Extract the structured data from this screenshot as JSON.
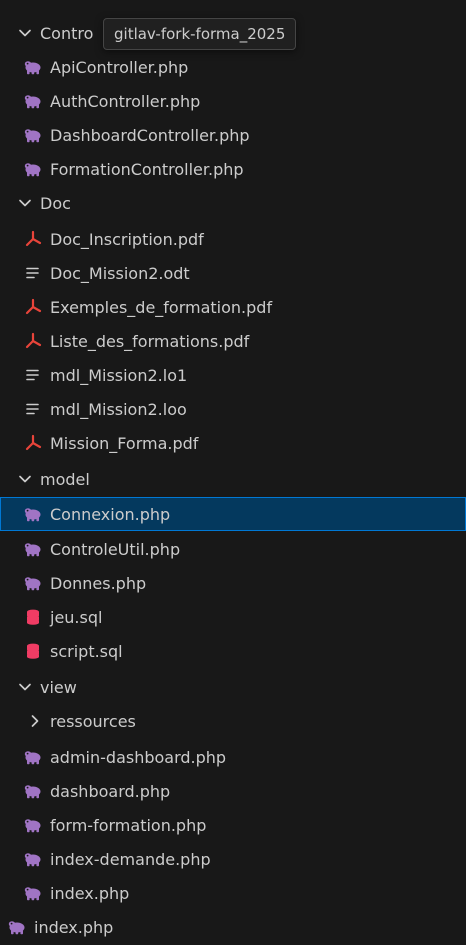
{
  "tooltip": "gitlav-fork-forma_2025",
  "colors": {
    "background": "#181818",
    "selected_bg": "#04395e",
    "selected_border": "#0078d4",
    "php_icon": "#a074c4",
    "pdf_icon": "#e8443a",
    "sql_icon": "#f03c64",
    "text": "#cccccc"
  },
  "tree": {
    "controller_folder": "Contro",
    "controller_files": [
      "ApiController.php",
      "AuthController.php",
      "DashboardController.php",
      "FormationController.php"
    ],
    "doc_folder": "Doc",
    "doc_files": [
      "Doc_Inscription.pdf",
      "Doc_Mission2.odt",
      "Exemples_de_formation.pdf",
      "Liste_des_formations.pdf",
      "mdl_Mission2.lo1",
      "mdl_Mission2.loo",
      "Mission_Forma.pdf"
    ],
    "model_folder": "model",
    "model_files": [
      "Connexion.php",
      "ControleUtil.php",
      "Donnes.php",
      "jeu.sql",
      "script.sql"
    ],
    "view_folder": "view",
    "view_subfolder": "ressources",
    "view_files": [
      "admin-dashboard.php",
      "dashboard.php",
      "form-formation.php",
      "index-demande.php",
      "index.php"
    ],
    "root_file": "index.php"
  }
}
